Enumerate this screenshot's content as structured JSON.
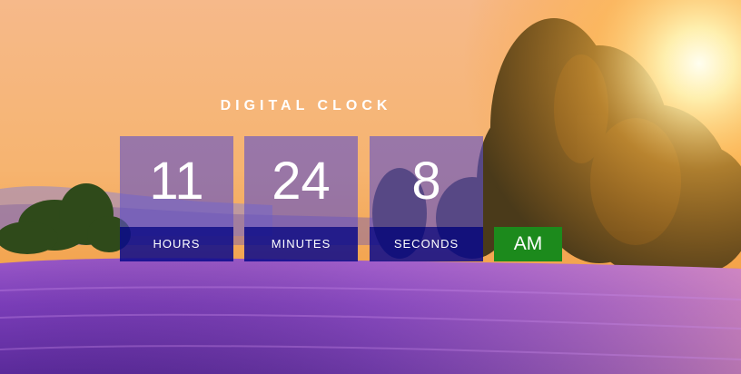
{
  "clock": {
    "title": "DIGITAL CLOCK",
    "hours": {
      "value": "11",
      "label": "HOURS"
    },
    "minutes": {
      "value": "24",
      "label": "MINUTES"
    },
    "seconds": {
      "value": "8",
      "label": "SECONDS"
    },
    "period": "AM"
  },
  "colors": {
    "number_tile": "#5f50c8",
    "label_tile": "#0a0a8c",
    "period_badge": "#1c8a1c"
  }
}
